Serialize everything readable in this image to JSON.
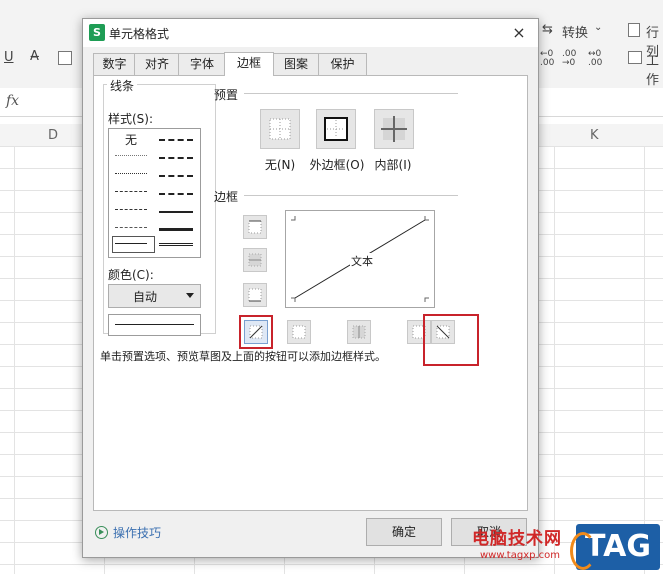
{
  "spreadsheet": {
    "ribbon": {
      "underline": "U",
      "convert": "转换",
      "rows_cols": "行列",
      "worksheet": "工作"
    },
    "fx": "fx",
    "columns": [
      "D",
      "K"
    ]
  },
  "dialog": {
    "app_icon": "S",
    "title": "单元格格式",
    "close": "×",
    "tabs": [
      {
        "label": "数字"
      },
      {
        "label": "对齐"
      },
      {
        "label": "字体"
      },
      {
        "label": "边框"
      },
      {
        "label": "图案"
      },
      {
        "label": "保护"
      }
    ],
    "active_tab": "边框",
    "line": {
      "group_title": "线条",
      "style_label": "样式(S):",
      "style_none": "无",
      "color_label": "颜色(C):",
      "color_value": "自动"
    },
    "presets": {
      "title": "预置",
      "none": "无(N)",
      "outline": "外边框(O)",
      "inside": "内部(I)"
    },
    "border": {
      "title": "边框",
      "preview_text": "文本"
    },
    "hint": "单击预置选项、预览草图及上面的按钮可以添加边框样式。",
    "tips": "操作技巧",
    "ok": "确定",
    "cancel": "取消"
  },
  "watermark": {
    "site_cn": "电脑技术网",
    "url": "www.tagxp.com",
    "logo": "TAG"
  },
  "colors": {
    "highlight_box": "#c8232b",
    "app_icon": "#1e9d55",
    "logo_bg": "#1d5fa6"
  }
}
